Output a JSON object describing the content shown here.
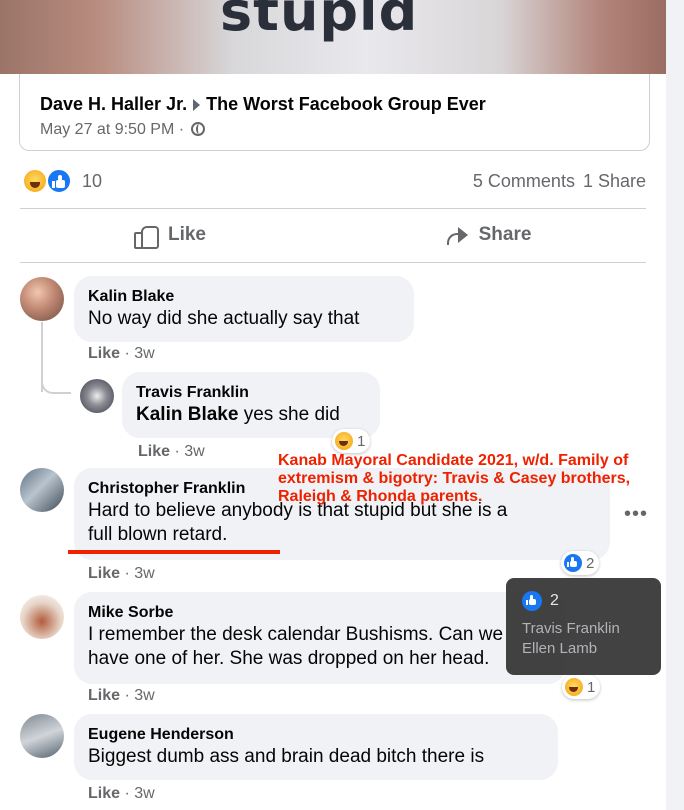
{
  "post": {
    "image_text": "stupid",
    "shared_author": "Dave H. Haller Jr.",
    "shared_group": "The Worst Facebook Group Ever",
    "shared_time": "May 27 at 9:50 PM",
    "shared_dot": "·"
  },
  "stats": {
    "reaction_count": "10",
    "comments": "5 Comments",
    "shares": "1 Share",
    "reaction_icons": [
      "haha-icon",
      "like-icon"
    ]
  },
  "actions": {
    "like_label": "Like",
    "share_label": "Share"
  },
  "comments": [
    {
      "name": "Kalin Blake",
      "text": "No way did she actually say that",
      "like": "Like",
      "time": "· 3w"
    },
    {
      "name": "Travis Franklin",
      "mention": "Kalin Blake",
      "text": " yes she did",
      "like": "Like",
      "time": "· 3w",
      "reaction_count": "1"
    },
    {
      "name": "Christopher Franklin",
      "text_line1": "Hard to believe anybody is that stupid but she is a",
      "text_line2": "full blown retard.",
      "like": "Like",
      "time": "· 3w",
      "reaction_count": "2"
    },
    {
      "name": "Mike Sorbe",
      "text_line1": "I remember the desk calendar Bushisms. Can we",
      "text_line2": "have one of her. She was dropped on her head.",
      "like": "Like",
      "time": "· 3w",
      "reaction_count": "1"
    },
    {
      "name": "Eugene Henderson",
      "text": "Biggest dumb ass and brain dead bitch there is",
      "like": "Like",
      "time": "· 3w"
    }
  ],
  "annotation": {
    "line1": "Kanab Mayoral Candidate 2021, w/d. Family of",
    "line2": "extremism & bigotry: Travis & Casey brothers,",
    "line3": "Raleigh & Rhonda parents."
  },
  "tooltip": {
    "count": "2",
    "names": [
      "Travis Franklin",
      "Ellen Lamb"
    ]
  },
  "colors": {
    "accent": "#1877f2",
    "annotation": "#ee2200",
    "bubble": "#f0f2f5",
    "muted": "#65676b"
  }
}
